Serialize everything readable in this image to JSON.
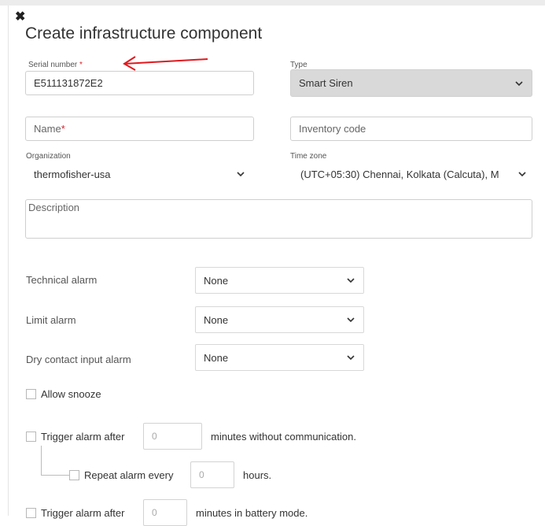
{
  "dialog": {
    "close_glyph": "✖",
    "title": "Create infrastructure component"
  },
  "serial": {
    "label": "Serial number",
    "required_mark": "*",
    "value": "E511131872E2"
  },
  "type": {
    "label": "Type",
    "value": "Smart Siren"
  },
  "name": {
    "placeholder": "Name",
    "required_mark": "*"
  },
  "inventory": {
    "placeholder": "Inventory code"
  },
  "organization": {
    "label": "Organization",
    "value": "thermofisher-usa"
  },
  "timezone": {
    "label": "Time zone",
    "value": "(UTC+05:30) Chennai, Kolkata (Calcuta), M"
  },
  "description": {
    "placeholder": "Description"
  },
  "alarms": {
    "technical": {
      "label": "Technical alarm",
      "value": "None"
    },
    "limit": {
      "label": "Limit alarm",
      "value": "None"
    },
    "dry_contact": {
      "label": "Dry contact input alarm",
      "value": "None"
    }
  },
  "snooze": {
    "label": "Allow snooze"
  },
  "trigger_comm": {
    "label": "Trigger alarm after",
    "value": "0",
    "suffix": "minutes without communication."
  },
  "repeat": {
    "label": "Repeat alarm every",
    "value": "0",
    "suffix": "hours."
  },
  "trigger_battery": {
    "label": "Trigger alarm after",
    "value": "0",
    "suffix": "minutes in battery mode."
  },
  "annotation": {
    "arrow_color": "#e0191e"
  }
}
